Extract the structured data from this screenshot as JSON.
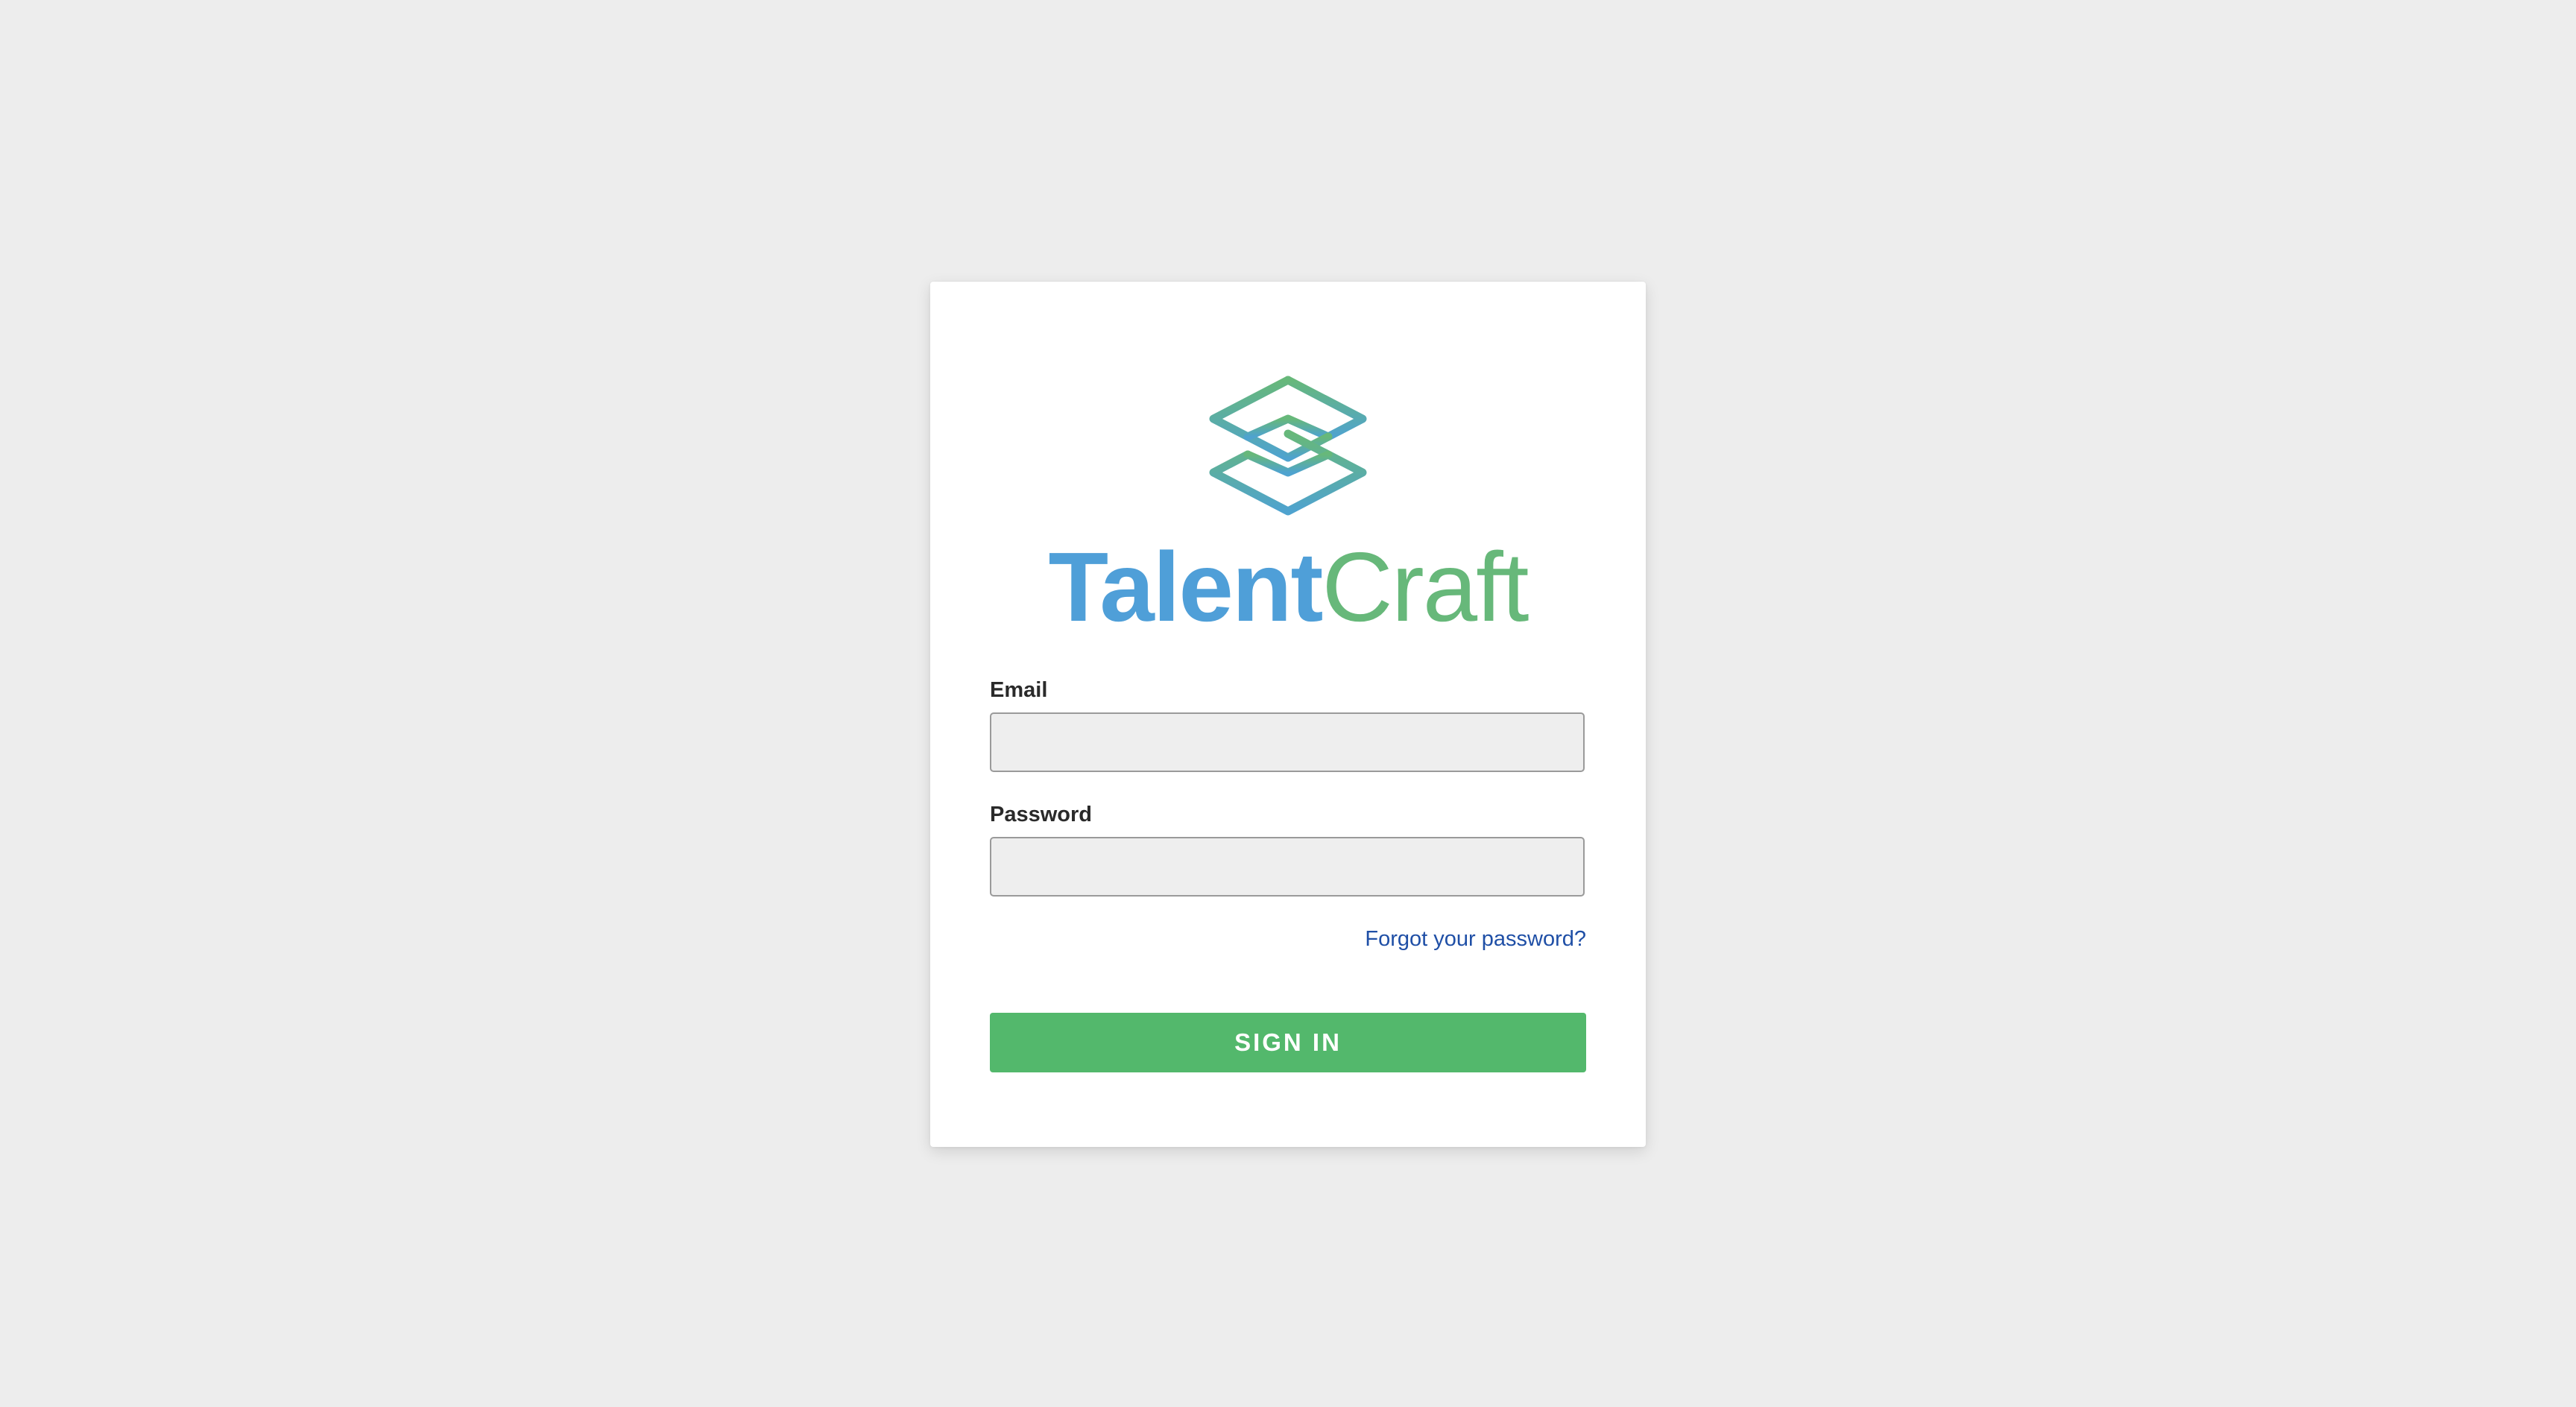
{
  "brand": {
    "name_part1": "Talent",
    "name_part2": "Craft",
    "colors": {
      "blue": "#4f9fd8",
      "green": "#67b87a",
      "teal": "#5bafa9"
    },
    "logo_icon": "stacked-diamond-logo-icon"
  },
  "form": {
    "email": {
      "label": "Email",
      "value": "",
      "placeholder": ""
    },
    "password": {
      "label": "Password",
      "value": "",
      "placeholder": ""
    },
    "forgot_link": "Forgot your password?",
    "submit_label": "SIGN IN"
  },
  "theme": {
    "page_bg": "#ededed",
    "card_bg": "#ffffff",
    "button_bg": "#53b86c",
    "link_color": "#1f4fa6"
  }
}
